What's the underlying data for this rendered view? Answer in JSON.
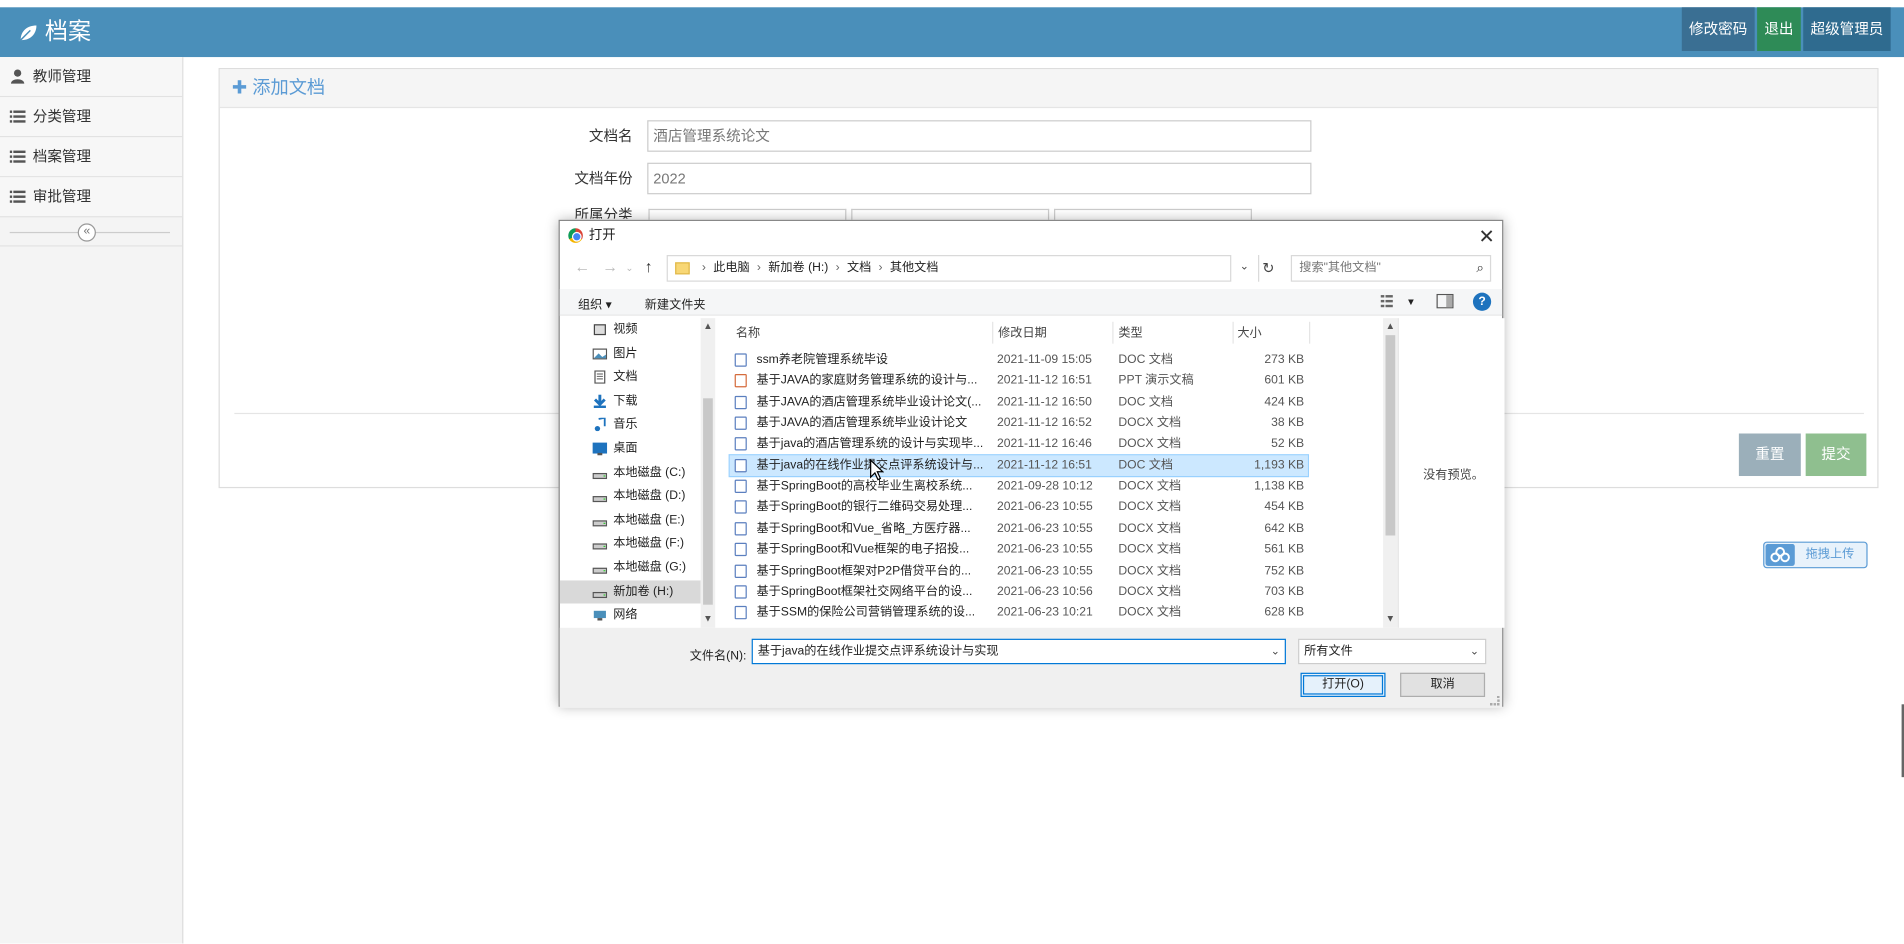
{
  "app": {
    "brand": "档案",
    "topnav": [
      "修改密码",
      "退出",
      "超级管理员"
    ]
  },
  "sidebar": {
    "items": [
      {
        "label": "教师管理",
        "icon": "user-icon"
      },
      {
        "label": "分类管理",
        "icon": "list-icon"
      },
      {
        "label": "档案管理",
        "icon": "list-icon"
      },
      {
        "label": "审批管理",
        "icon": "list-icon"
      }
    ],
    "collapse_glyph": "«"
  },
  "panel": {
    "title": "添加文档",
    "fields": [
      {
        "label": "文档名",
        "value": "酒店管理系统论文"
      },
      {
        "label": "文档年份",
        "value": "2022"
      }
    ],
    "category_label": "所属分类",
    "reset_label": "重置",
    "submit_label": "提交",
    "drag_upload_label": "拖拽上传"
  },
  "dialog": {
    "title": "打开",
    "breadcrumb": [
      "此电脑",
      "新加卷 (H:)",
      "文档",
      "其他文档"
    ],
    "search_placeholder": "搜索\"其他文档\"",
    "organize_label": "组织 ▾",
    "new_folder_label": "新建文件夹",
    "tree": [
      {
        "label": "视频",
        "icon": "video-icon"
      },
      {
        "label": "图片",
        "icon": "pictures-icon"
      },
      {
        "label": "文档",
        "icon": "documents-icon"
      },
      {
        "label": "下载",
        "icon": "download-icon"
      },
      {
        "label": "音乐",
        "icon": "music-icon"
      },
      {
        "label": "桌面",
        "icon": "desktop-icon"
      },
      {
        "label": "本地磁盘 (C:)",
        "icon": "drive-icon"
      },
      {
        "label": "本地磁盘 (D:)",
        "icon": "drive-icon"
      },
      {
        "label": "本地磁盘 (E:)",
        "icon": "drive-icon"
      },
      {
        "label": "本地磁盘 (F:)",
        "icon": "drive-icon"
      },
      {
        "label": "本地磁盘 (G:)",
        "icon": "drive-icon"
      },
      {
        "label": "新加卷 (H:)",
        "icon": "drive-icon",
        "selected": true
      },
      {
        "label": "网络",
        "icon": "network-icon"
      }
    ],
    "columns": [
      "名称",
      "修改日期",
      "类型",
      "大小"
    ],
    "files": [
      {
        "name": "ssm养老院管理系统毕设",
        "date": "2021-11-09 15:05",
        "type": "DOC 文档",
        "size": "273 KB"
      },
      {
        "name": "基于JAVA的家庭财务管理系统的设计与...",
        "date": "2021-11-12 16:51",
        "type": "PPT 演示文稿",
        "size": "601 KB",
        "ppt": true
      },
      {
        "name": "基于JAVA的酒店管理系统毕业设计论文(...",
        "date": "2021-11-12 16:50",
        "type": "DOC 文档",
        "size": "424 KB"
      },
      {
        "name": "基于JAVA的酒店管理系统毕业设计论文",
        "date": "2021-11-12 16:52",
        "type": "DOCX 文档",
        "size": "38 KB"
      },
      {
        "name": "基于java的酒店管理系统的设计与实现毕...",
        "date": "2021-11-12 16:46",
        "type": "DOCX 文档",
        "size": "52 KB"
      },
      {
        "name": "基于java的在线作业提交点评系统设计与...",
        "date": "2021-11-12 16:51",
        "type": "DOC 文档",
        "size": "1,193 KB",
        "selected": true
      },
      {
        "name": "基于SpringBoot的高校毕业生离校系统...",
        "date": "2021-09-28 10:12",
        "type": "DOCX 文档",
        "size": "1,138 KB"
      },
      {
        "name": "基于SpringBoot的银行二维码交易处理...",
        "date": "2021-06-23 10:55",
        "type": "DOCX 文档",
        "size": "454 KB"
      },
      {
        "name": "基于SpringBoot和Vue_省略_方医疗器...",
        "date": "2021-06-23 10:55",
        "type": "DOCX 文档",
        "size": "642 KB"
      },
      {
        "name": "基于SpringBoot和Vue框架的电子招投...",
        "date": "2021-06-23 10:55",
        "type": "DOCX 文档",
        "size": "561 KB"
      },
      {
        "name": "基于SpringBoot框架对P2P借贷平台的...",
        "date": "2021-06-23 10:55",
        "type": "DOCX 文档",
        "size": "752 KB"
      },
      {
        "name": "基于SpringBoot框架社交网络平台的设...",
        "date": "2021-06-23 10:56",
        "type": "DOCX 文档",
        "size": "703 KB"
      },
      {
        "name": "基于SSM的保险公司营销管理系统的设...",
        "date": "2021-06-23 10:21",
        "type": "DOCX 文档",
        "size": "628 KB"
      }
    ],
    "no_preview": "没有预览。",
    "filename_label": "文件名(N):",
    "filename_value": "基于java的在线作业提交点评系统设计与实现",
    "filter_value": "所有文件",
    "open_label": "打开(O)",
    "cancel_label": "取消"
  },
  "colors": {
    "header": "#4a8fba",
    "accent": "#5b9bd5",
    "selection": "#cce8ff"
  }
}
